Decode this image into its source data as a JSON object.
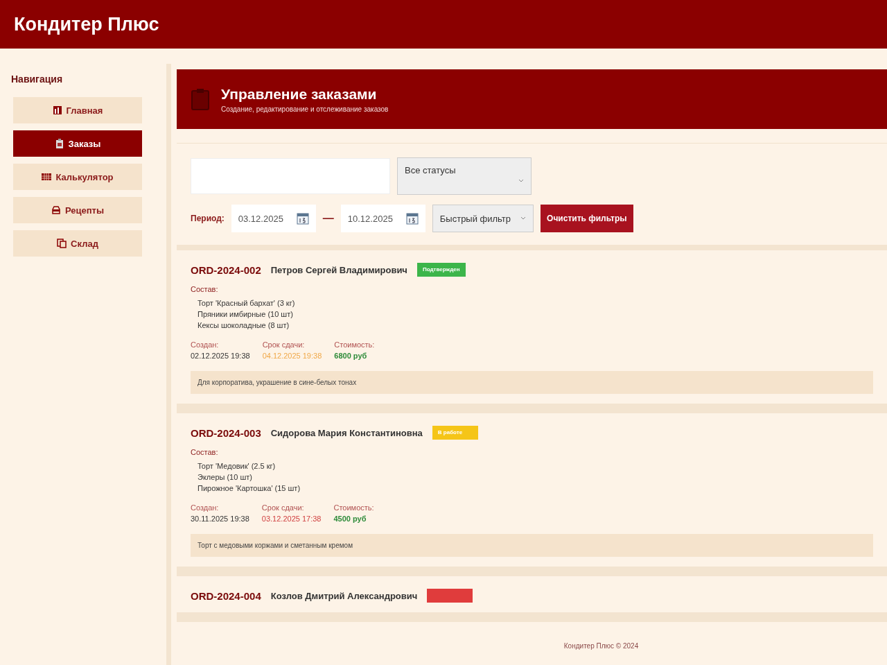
{
  "app_title": "Кондитер Плюс",
  "sidebar": {
    "title": "Навигация",
    "items": [
      {
        "label": "Главная",
        "selected": false
      },
      {
        "label": "Заказы",
        "selected": true
      },
      {
        "label": "Калькулятор",
        "selected": false
      },
      {
        "label": "Рецепты",
        "selected": false
      },
      {
        "label": "Склад",
        "selected": false
      }
    ]
  },
  "page_header": {
    "title": "Управление заказами",
    "subtitle": "Создание, редактирование и отслеживание заказов"
  },
  "filters": {
    "status_select": "Все статусы",
    "period_label": "Период:",
    "date_from": "03.12.2025",
    "date_separator": "—",
    "date_to": "10.12.2025",
    "quick_filter": "Быстрый фильтр",
    "clear_button": "Очистить фильтры"
  },
  "orders": [
    {
      "id": "ORD-2024-002",
      "customer": "Петров Сергей Владимирович",
      "status": {
        "kind": "confirmed",
        "label": "Подтвержден"
      },
      "composition_label": "Состав:",
      "items": [
        "Торт 'Красный бархат' (3 кг)",
        "Пряники имбирные (10 шт)",
        "Кексы шоколадные (8 шт)"
      ],
      "created_label": "Создан:",
      "created": "02.12.2025 19:38",
      "deadline_label": "Срок сдачи:",
      "deadline": "04.12.2025 19:38",
      "deadline_overdue": false,
      "cost_label": "Стоимость:",
      "cost": "6800 руб",
      "note": "Для корпоратива, украшение в сине-белых тонах"
    },
    {
      "id": "ORD-2024-003",
      "customer": "Сидорова Мария Константиновна",
      "status": {
        "kind": "in_progress",
        "label": "В работе"
      },
      "composition_label": "Состав:",
      "items": [
        "Торт 'Медовик' (2.5 кг)",
        "Эклеры (10 шт)",
        "Пирожное 'Картошка' (15 шт)"
      ],
      "created_label": "Создан:",
      "created": "30.11.2025 19:38",
      "deadline_label": "Срок сдачи:",
      "deadline": "03.12.2025 17:38",
      "deadline_overdue": true,
      "cost_label": "Стоимость:",
      "cost": "4500 руб",
      "note": "Торт с медовыми коржами и сметанным кремом"
    },
    {
      "id": "ORD-2024-004",
      "customer": "Козлов Дмитрий Александрович",
      "status": {
        "kind": "urgent"
      }
    }
  ],
  "footer": "Кондитер Плюс © 2024"
}
